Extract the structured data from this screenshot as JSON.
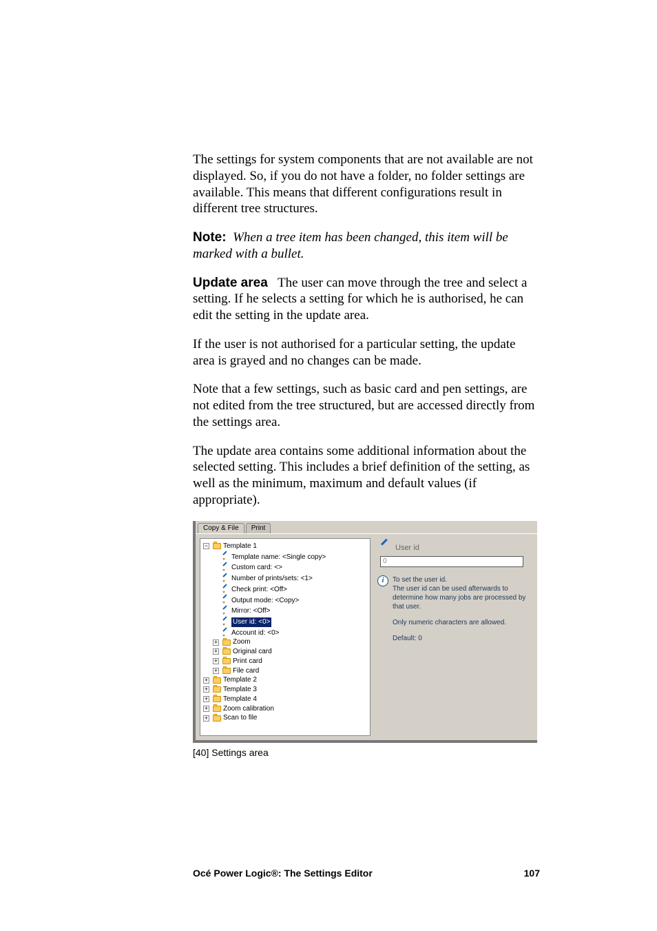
{
  "paragraphs": {
    "p1": "The settings for system components that are not available are not displayed. So, if you do not have a folder, no folder settings are available. This means that different configurations result in different tree structures.",
    "note_lead": "Note:",
    "note_body": "When a tree item has been changed, this item will be marked with a bullet.",
    "ua_lead": "Update area",
    "ua_body": "The user can move through the tree and select a setting. If he selects a setting for which he is authorised, he can edit the setting in the update area.",
    "p3": "If the user is not authorised for a particular setting, the update area is grayed and no changes can be made.",
    "p4": "Note that a few settings, such as basic card and pen settings, are not edited from the tree structured, but are accessed directly from the settings area.",
    "p5": "The update area contains some additional information about the selected setting. This includes a brief definition of the setting, as well as the minimum, maximum and default values (if appropriate)."
  },
  "figure": {
    "tabs": {
      "active": "Copy & File",
      "inactive": "Print"
    },
    "tree": {
      "t1": {
        "label": "Template 1",
        "items": {
          "tname": "Template name: <Single copy>",
          "ccard": "Custom card: <>",
          "npsets": "Number of prints/sets: <1>",
          "chk": "Check print: <Off>",
          "outm": "Output mode: <Copy>",
          "mir": "Mirror: <Off>",
          "uid": "User id: <0>",
          "aid": "Account id: <0>",
          "zoom": "Zoom",
          "ocard": "Original card",
          "pcard": "Print card",
          "fcard": "File card"
        }
      },
      "t2": "Template 2",
      "t3": "Template 3",
      "t4": "Template 4",
      "zcal": "Zoom calibration",
      "stf": "Scan to file"
    },
    "right": {
      "title": "User id",
      "input_value": "0",
      "info1": "To set the user id.",
      "info2": "The user id can be used afterwards to determine how many jobs are processed by that user.",
      "info3": "Only numeric characters are allowed.",
      "info4": "Default: 0"
    },
    "caption": "[40] Settings area"
  },
  "footer": {
    "title": "Océ Power Logic®: The Settings Editor",
    "page": "107"
  }
}
